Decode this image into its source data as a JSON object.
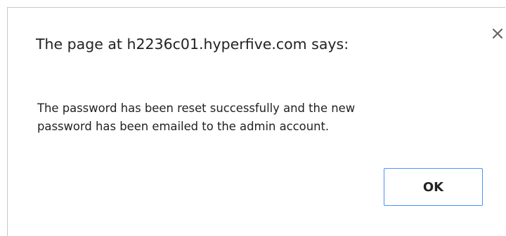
{
  "dialog": {
    "title": "The page at h2236c01.hyperfive.com says:",
    "close_glyph": "×",
    "close_icon": "close-icon",
    "message_line1": "The password has been reset successfully and the new",
    "message_line2": "password has been emailed to the admin account.",
    "ok_label": "OK",
    "accent_color": "#4d90fe"
  }
}
